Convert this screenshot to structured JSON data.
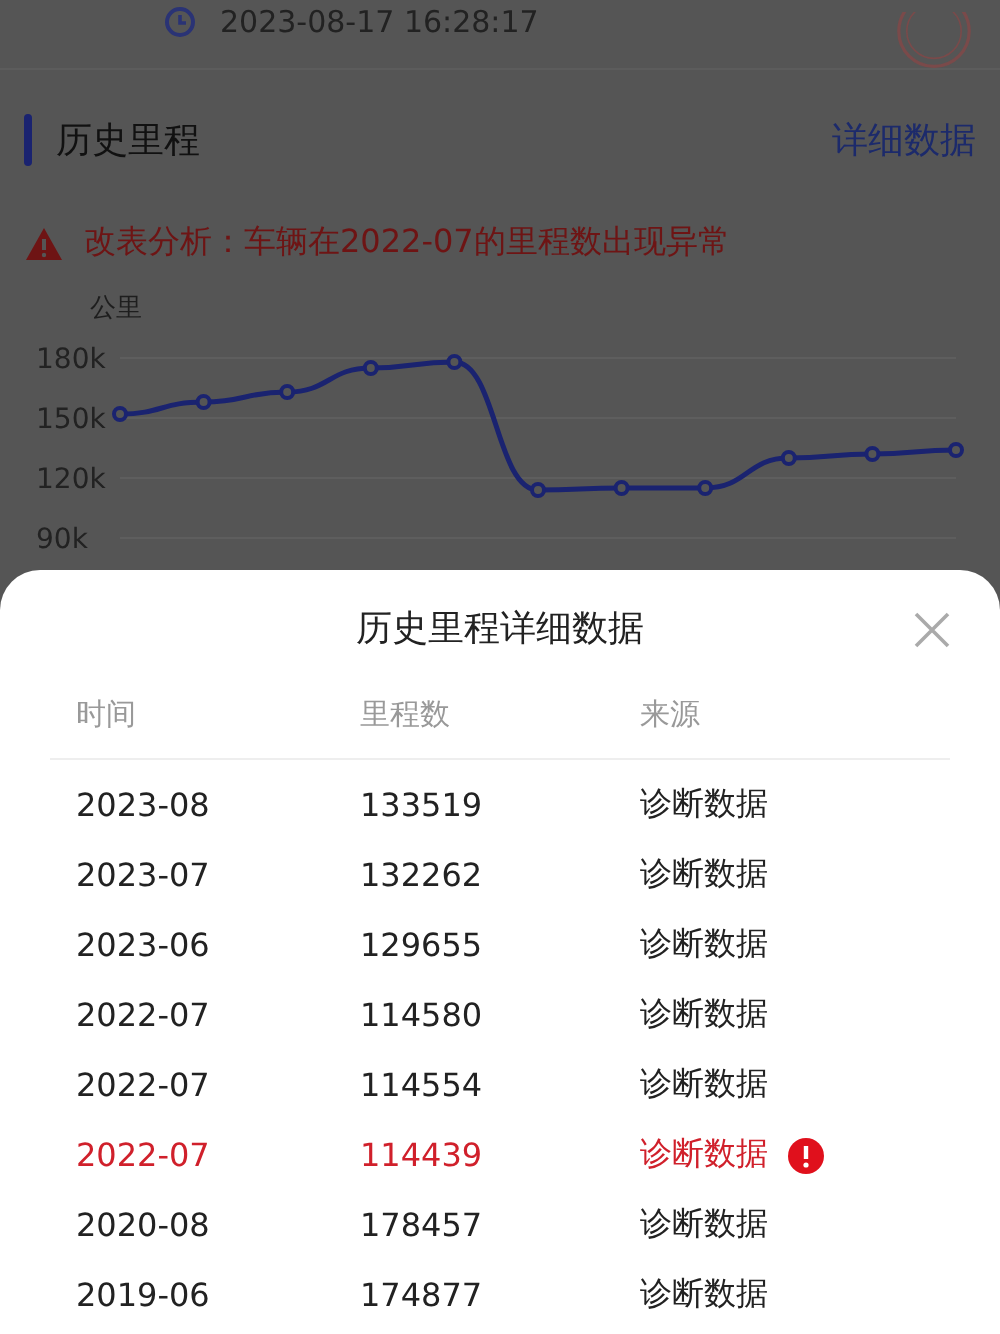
{
  "report_time": "2023-08-17 16:28:17",
  "section": {
    "title": "历史里程",
    "link": "详细数据"
  },
  "warning": "改表分析：车辆在2022-07的里程数出现异常",
  "chart": {
    "chart_data": {
      "type": "line",
      "ylabel": "公里",
      "ylim": [
        90000,
        180000
      ],
      "yticks": [
        {
          "value": 90000,
          "label": "90k"
        },
        {
          "value": 120000,
          "label": "120k"
        },
        {
          "value": 150000,
          "label": "150k"
        },
        {
          "value": 180000,
          "label": "180k"
        }
      ],
      "series": [
        {
          "color": "#1a2370",
          "marker": "circle",
          "values": [
            152000,
            158000,
            163000,
            175000,
            178000,
            114000,
            115000,
            115000,
            130000,
            132000,
            134000
          ]
        }
      ]
    }
  },
  "sheet": {
    "title": "历史里程详细数据",
    "columns": [
      "时间",
      "里程数",
      "来源"
    ],
    "rows": [
      {
        "time": "2023-08",
        "mileage": "133519",
        "source": "诊断数据",
        "abnormal": false
      },
      {
        "time": "2023-07",
        "mileage": "132262",
        "source": "诊断数据",
        "abnormal": false
      },
      {
        "time": "2023-06",
        "mileage": "129655",
        "source": "诊断数据",
        "abnormal": false
      },
      {
        "time": "2022-07",
        "mileage": "114580",
        "source": "诊断数据",
        "abnormal": false
      },
      {
        "time": "2022-07",
        "mileage": "114554",
        "source": "诊断数据",
        "abnormal": false
      },
      {
        "time": "2022-07",
        "mileage": "114439",
        "source": "诊断数据",
        "abnormal": true
      },
      {
        "time": "2020-08",
        "mileage": "178457",
        "source": "诊断数据",
        "abnormal": false
      },
      {
        "time": "2019-06",
        "mileage": "174877",
        "source": "诊断数据",
        "abnormal": false
      }
    ]
  }
}
